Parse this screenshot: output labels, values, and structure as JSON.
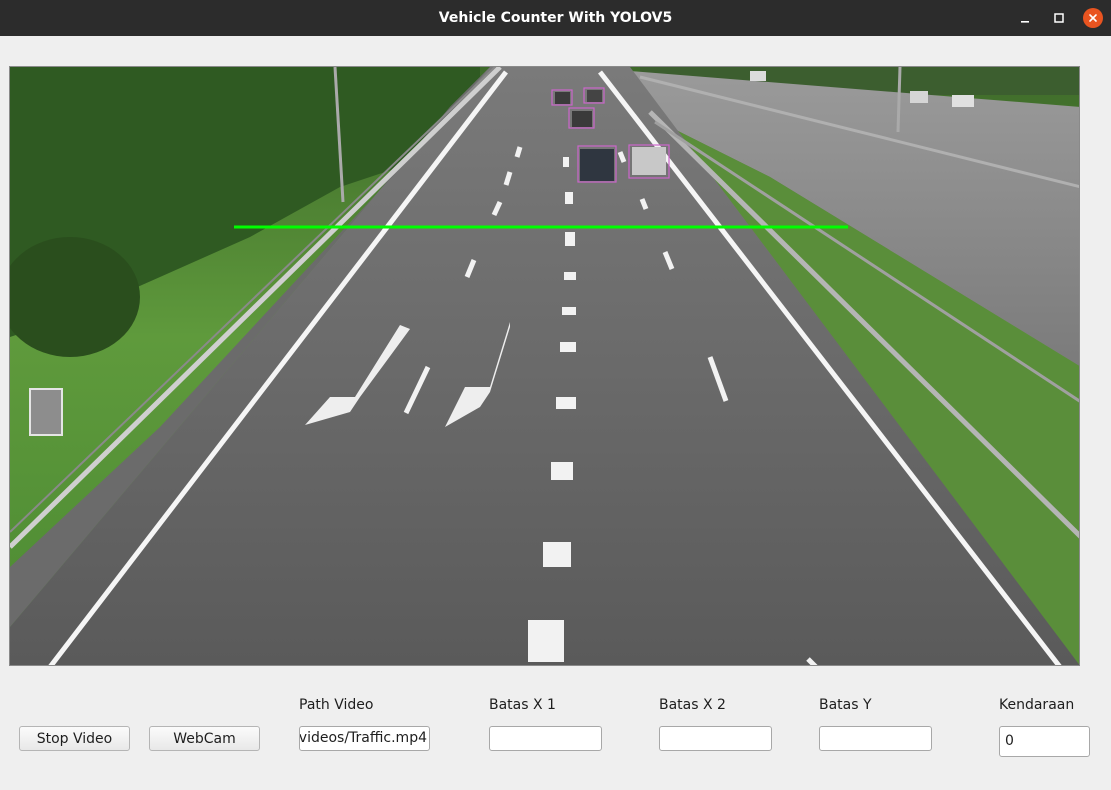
{
  "window": {
    "title": "Vehicle Counter With YOLOV5",
    "controls": [
      "minimize-icon",
      "maximize-icon",
      "close-icon"
    ],
    "accent_close": "#e95420"
  },
  "video": {
    "counting_line_color": "#00ff00",
    "detection_box_color": "#cc66cc"
  },
  "controls": {
    "stop_button": "Stop Video",
    "webcam_button": "WebCam",
    "path_label": "Path Video",
    "path_value": "videos/Traffic.mp4",
    "batas_x1_label": "Batas X 1",
    "batas_x1_value": "",
    "batas_x2_label": "Batas X 2",
    "batas_x2_value": "",
    "batas_y_label": "Batas Y",
    "batas_y_value": "",
    "kendaraan_label": "Kendaraan",
    "kendaraan_value": "0"
  }
}
